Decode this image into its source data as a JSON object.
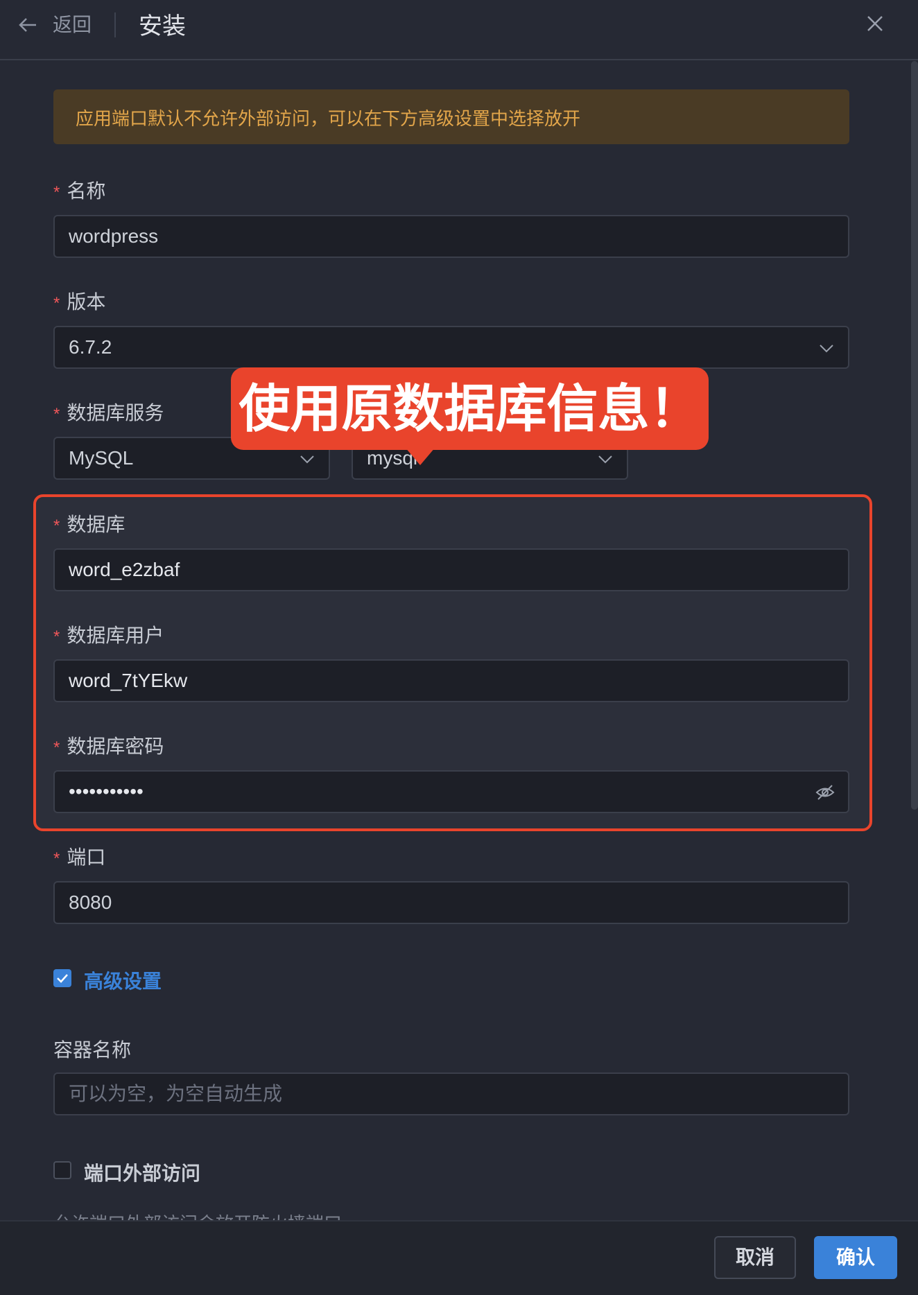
{
  "header": {
    "back_label": "返回",
    "title": "安装"
  },
  "notice": "应用端口默认不允许外部访问，可以在下方高级设置中选择放开",
  "form": {
    "required_mark": "*",
    "name": {
      "label": "名称",
      "value": "wordpress"
    },
    "version": {
      "label": "版本",
      "value": "6.7.2"
    },
    "db_service": {
      "label": "数据库服务",
      "type_value": "MySQL",
      "instance_value": "mysql"
    },
    "database": {
      "label": "数据库",
      "value": "word_e2zbaf"
    },
    "db_user": {
      "label": "数据库用户",
      "value": "word_7tYEkw"
    },
    "db_password": {
      "label": "数据库密码",
      "value": "•••••••••••"
    },
    "port": {
      "label": "端口",
      "value": "8080"
    },
    "advanced": {
      "label": "高级设置",
      "checked": true
    },
    "container_name": {
      "label": "容器名称",
      "placeholder": "可以为空，为空自动生成"
    },
    "port_external": {
      "label": "端口外部访问",
      "checked": false
    },
    "port_external_hint": "允许端口外部访问会放开防火墙端口"
  },
  "annotation": {
    "text": "使用原数据库信息！",
    "color": "#e9442c"
  },
  "footer": {
    "cancel_label": "取消",
    "confirm_label": "确认"
  },
  "colors": {
    "accent": "#3a82d9",
    "warning_text": "#e3a64a",
    "required": "#f0575a"
  }
}
